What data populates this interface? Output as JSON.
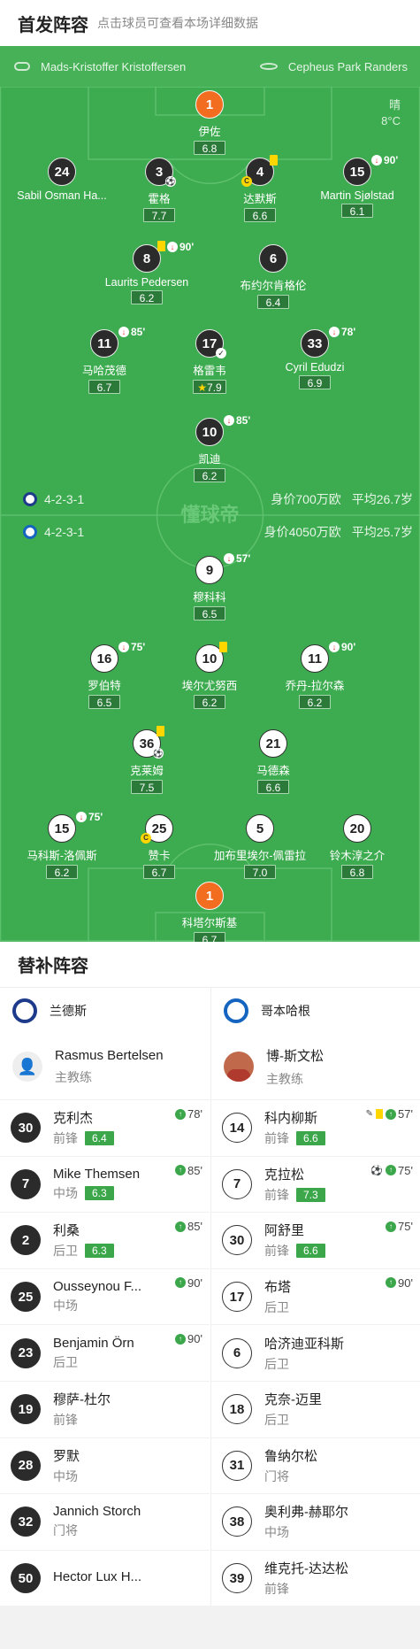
{
  "header": {
    "title": "首发阵容",
    "subtitle": "点击球员可查看本场详细数据"
  },
  "pitch": {
    "coach_home": "Mads-Kristoffer Kristoffersen",
    "venue": "Cepheus Park Randers",
    "weather": "晴",
    "temp": "8°C",
    "watermark": "懂球帝",
    "home_formation": "4-2-3-1",
    "home_value": "身价700万欧",
    "home_age": "平均26.7岁",
    "away_formation": "4-2-3-1",
    "away_value": "身价4050万欧",
    "away_age": "平均25.7岁"
  },
  "home_players": [
    {
      "num": "1",
      "name": "伊佐",
      "rating": "6.8"
    },
    {
      "num": "24",
      "name": "Sabil Osman Ha...",
      "rating": ""
    },
    {
      "num": "3",
      "name": "霍格",
      "rating": "7.7"
    },
    {
      "num": "4",
      "name": "达默斯",
      "rating": "6.6"
    },
    {
      "num": "15",
      "name": "Martin Sjølstad",
      "rating": "6.1",
      "min": "90'"
    },
    {
      "num": "8",
      "name": "Laurits Pedersen",
      "rating": "6.2",
      "min": "90'"
    },
    {
      "num": "6",
      "name": "布约尔肯格伦",
      "rating": "6.4"
    },
    {
      "num": "11",
      "name": "马哈茂德",
      "rating": "6.7",
      "min": "85'"
    },
    {
      "num": "17",
      "name": "格雷韦",
      "rating": "7.9"
    },
    {
      "num": "33",
      "name": "Cyril Edudzi",
      "rating": "6.9",
      "min": "78'"
    },
    {
      "num": "10",
      "name": "凯迪",
      "rating": "6.2",
      "min": "85'"
    }
  ],
  "away_players": [
    {
      "num": "9",
      "name": "穆科科",
      "rating": "6.5",
      "min": "57'"
    },
    {
      "num": "16",
      "name": "罗伯特",
      "rating": "6.5",
      "min": "75'"
    },
    {
      "num": "10",
      "name": "埃尔尤努西",
      "rating": "6.2"
    },
    {
      "num": "11",
      "name": "乔丹-拉尔森",
      "rating": "6.2",
      "min": "90'"
    },
    {
      "num": "36",
      "name": "克莱姆",
      "rating": "7.5"
    },
    {
      "num": "21",
      "name": "马德森",
      "rating": "6.6"
    },
    {
      "num": "15",
      "name": "马科斯-洛佩斯",
      "rating": "6.2",
      "min": "75'"
    },
    {
      "num": "25",
      "name": "赞卡",
      "rating": "6.7"
    },
    {
      "num": "5",
      "name": "加布里埃尔-佩雷拉",
      "rating": "7.0"
    },
    {
      "num": "20",
      "name": "铃木淳之介",
      "rating": "6.8"
    },
    {
      "num": "1",
      "name": "科塔尔斯基",
      "rating": "6.7"
    }
  ],
  "subs": {
    "title": "替补阵容",
    "home_team": "兰德斯",
    "away_team": "哥本哈根",
    "home_coach": {
      "name": "Rasmus Bertelsen",
      "role": "主教练"
    },
    "away_coach": {
      "name": "博-斯文松",
      "role": "主教练"
    },
    "home": [
      {
        "num": "30",
        "name": "克利杰",
        "pos": "前锋",
        "rating": "6.4",
        "min": "78'"
      },
      {
        "num": "7",
        "name": "Mike Themsen",
        "pos": "中场",
        "rating": "6.3",
        "min": "85'"
      },
      {
        "num": "2",
        "name": "利桑",
        "pos": "后卫",
        "rating": "6.3",
        "min": "85'"
      },
      {
        "num": "25",
        "name": "Ousseynou F...",
        "pos": "中场",
        "rating": "",
        "min": "90'"
      },
      {
        "num": "23",
        "name": "Benjamin Örn",
        "pos": "后卫",
        "rating": "",
        "min": "90'"
      },
      {
        "num": "19",
        "name": "穆萨-杜尔",
        "pos": "前锋",
        "rating": "",
        "min": ""
      },
      {
        "num": "28",
        "name": "罗默",
        "pos": "中场",
        "rating": "",
        "min": ""
      },
      {
        "num": "32",
        "name": "Jannich Storch",
        "pos": "门将",
        "rating": "",
        "min": ""
      },
      {
        "num": "50",
        "name": "Hector Lux H...",
        "pos": "",
        "rating": "",
        "min": ""
      }
    ],
    "away": [
      {
        "num": "14",
        "name": "科内柳斯",
        "pos": "前锋",
        "rating": "6.6",
        "min": "57'"
      },
      {
        "num": "7",
        "name": "克拉松",
        "pos": "前锋",
        "rating": "7.3",
        "min": "75'"
      },
      {
        "num": "30",
        "name": "阿舒里",
        "pos": "前锋",
        "rating": "6.6",
        "min": "75'"
      },
      {
        "num": "17",
        "name": "布塔",
        "pos": "后卫",
        "rating": "",
        "min": "90'"
      },
      {
        "num": "6",
        "name": "哈济迪亚科斯",
        "pos": "后卫",
        "rating": "",
        "min": ""
      },
      {
        "num": "18",
        "name": "克奈-迈里",
        "pos": "后卫",
        "rating": "",
        "min": ""
      },
      {
        "num": "31",
        "name": "鲁纳尔松",
        "pos": "门将",
        "rating": "",
        "min": ""
      },
      {
        "num": "38",
        "name": "奥利弗-赫耶尔",
        "pos": "中场",
        "rating": "",
        "min": ""
      },
      {
        "num": "39",
        "name": "维克托-达达松",
        "pos": "前锋",
        "rating": "",
        "min": ""
      }
    ]
  }
}
